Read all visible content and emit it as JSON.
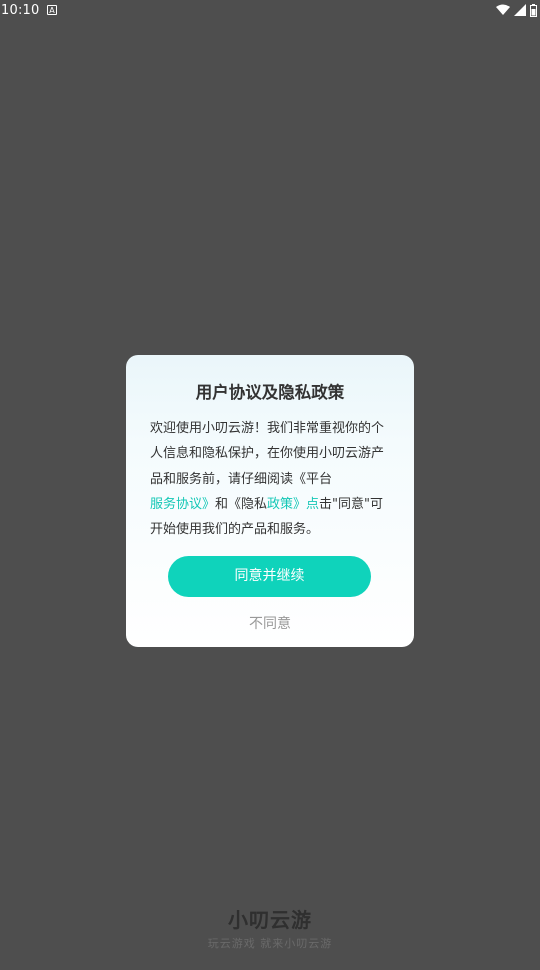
{
  "status_bar": {
    "time": "10:10",
    "notification_icon": "A"
  },
  "dialog": {
    "title": "用户协议及隐私政策",
    "body": {
      "part1": "欢迎使用小叨云游！我们非常重视你的个人信息和隐私保护，在你使用小叨云游产品和服务前，请仔细阅读《平台",
      "link1": "服务协议》",
      "part2": "和《隐私",
      "link2": "政策》点",
      "part3": "击\"同意\"可开始使用我们的产品和服务。"
    },
    "agree_label": "同意并继续",
    "disagree_label": "不同意"
  },
  "footer": {
    "brand": "小叨云游",
    "slogan": "玩云游戏 就来小叨云游"
  },
  "colors": {
    "backdrop": "#4e4e4e",
    "accent": "#0fd3bb",
    "link": "#14c7b6"
  }
}
